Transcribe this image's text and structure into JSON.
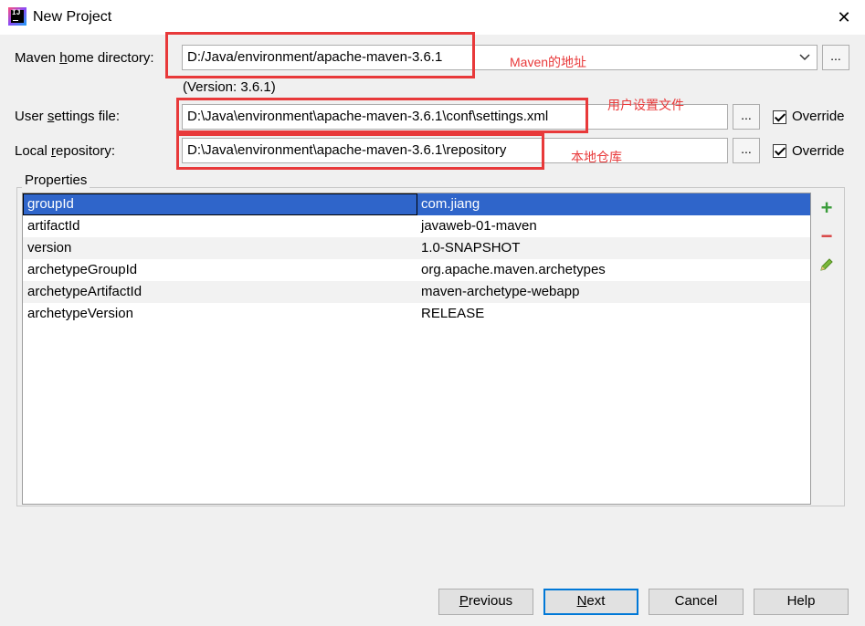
{
  "window": {
    "title": "New Project",
    "close_glyph": "✕",
    "icon": "intellij-idea-icon",
    "icon_text": "IJ"
  },
  "maven_home": {
    "label_pre": "Maven ",
    "label_mn": "h",
    "label_post": "ome directory:",
    "value": "D:/Java/environment/apache-maven-3.6.1",
    "version": "(Version: 3.6.1)",
    "browse": "..."
  },
  "user_settings": {
    "label_pre": "User ",
    "label_mn": "s",
    "label_post": "ettings file:",
    "value": "D:\\Java\\environment\\apache-maven-3.6.1\\conf\\settings.xml",
    "browse": "...",
    "override_label": "Override",
    "override_checked": true
  },
  "local_repo": {
    "label_pre": "Local ",
    "label_mn": "r",
    "label_post": "epository:",
    "value": "D:\\Java\\environment\\apache-maven-3.6.1\\repository",
    "browse": "...",
    "override_label": "Override",
    "override_checked": true
  },
  "annotations": {
    "maven_home": "Maven的地址",
    "user_settings": "用户设置文件",
    "local_repo": "本地仓库",
    "color": "#e8393a"
  },
  "properties": {
    "title": "Properties",
    "rows": [
      {
        "key": "groupId",
        "value": "com.jiang",
        "selected": true
      },
      {
        "key": "artifactId",
        "value": "javaweb-01-maven"
      },
      {
        "key": "version",
        "value": "1.0-SNAPSHOT"
      },
      {
        "key": "archetypeGroupId",
        "value": "org.apache.maven.archetypes"
      },
      {
        "key": "archetypeArtifactId",
        "value": "maven-archetype-webapp"
      },
      {
        "key": "archetypeVersion",
        "value": "RELEASE"
      }
    ],
    "actions": {
      "add": "+",
      "remove": "−",
      "edit": "✎"
    }
  },
  "buttons": {
    "previous": {
      "mn": "P",
      "rest": "revious"
    },
    "next": {
      "mn": "N",
      "rest": "ext"
    },
    "cancel": "Cancel",
    "help": "Help"
  },
  "colors": {
    "selection": "#2f65ca",
    "accent": "#0078d7",
    "add": "#3a9c3a",
    "remove": "#d84040"
  }
}
